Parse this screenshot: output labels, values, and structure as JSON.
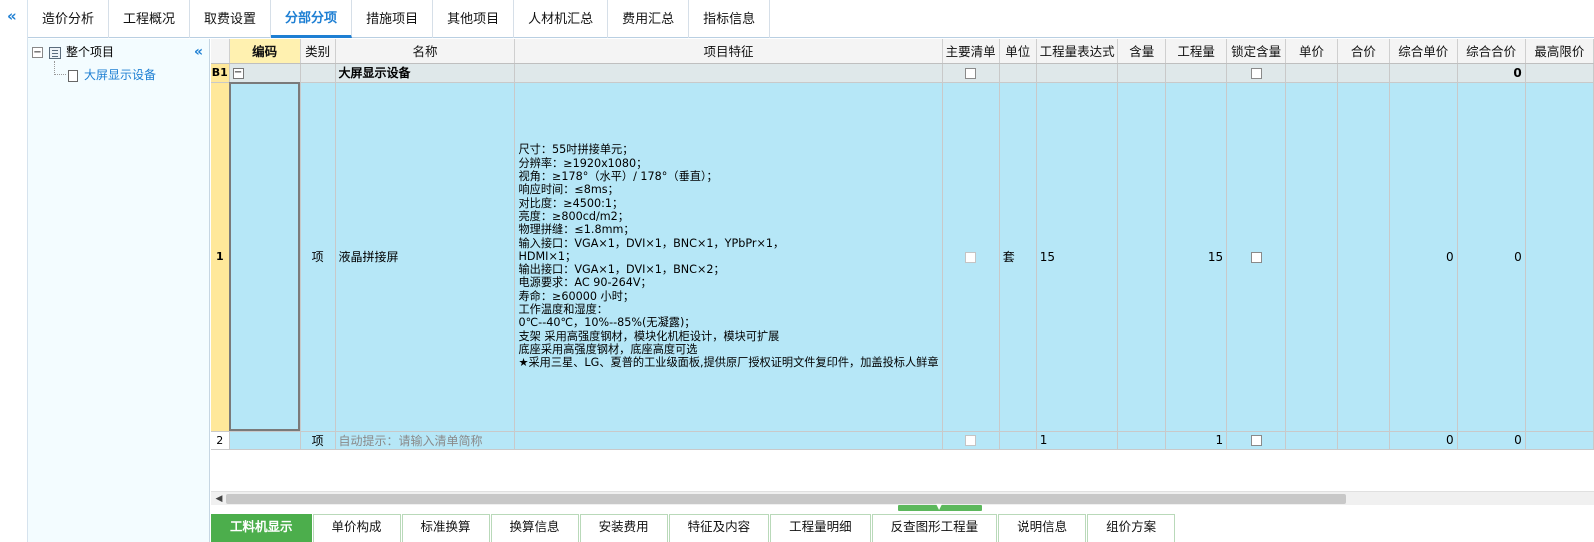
{
  "top_tabs": [
    "造价分析",
    "工程概况",
    "取费设置",
    "分部分项",
    "措施项目",
    "其他项目",
    "人材机汇总",
    "费用汇总",
    "指标信息"
  ],
  "active_top_tab": "分部分项",
  "tree": {
    "root_label": "整个项目",
    "root_toggle": "−",
    "child_label": "大屏显示设备"
  },
  "columns": [
    "",
    "编码",
    "类别",
    "名称",
    "项目特征",
    "主要清单",
    "单位",
    "工程量表达式",
    "含量",
    "工程量",
    "锁定含量",
    "单价",
    "合价",
    "综合单价",
    "综合合价",
    "最高限价"
  ],
  "rows": {
    "section": {
      "num": "B1",
      "toggle": "−",
      "name": "大屏显示设备",
      "total": "0"
    },
    "item1": {
      "num": "1",
      "type": "项",
      "name": "液晶拼接屏",
      "feature_lines": [
        "尺寸：55吋拼接单元；",
        "分辨率：≥1920x1080；",
        "视角：≥178°（水平）/ 178°（垂直）；",
        "响应时间：≤8ms；",
        "对比度：≥4500:1；",
        "亮度：≥800cd/m2；",
        "物理拼缝：≤1.8mm；",
        "输入接口：VGA×1，DVI×1，BNC×1，YPbPr×1，",
        "HDMI×1；",
        "输出接口：VGA×1，DVI×1，BNC×2；",
        "电源要求：AC 90-264V；",
        "寿命：≥60000 小时；",
        "工作温度和湿度：",
        "0℃--40℃，10%--85%(无凝露)；",
        "支架 采用高强度钢材，模块化机柜设计，模块可扩展",
        "底座采用高强度钢材，底座高度可选",
        "★采用三星、LG、夏普的工业级面板,提供原厂授权证明文件复印件，加盖投标人鲜章"
      ],
      "unit": "套",
      "expression": "15",
      "quantity": "15",
      "composite_price": "0",
      "composite_total": "0"
    },
    "item2": {
      "num": "2",
      "type": "项",
      "name_hint": "自动提示：请输入清单简称",
      "expression": "1",
      "quantity": "1",
      "composite_price": "0",
      "composite_total": "0"
    }
  },
  "bottom_tabs": [
    "工料机显示",
    "单价构成",
    "标准换算",
    "换算信息",
    "安装费用",
    "特征及内容",
    "工程量明细",
    "反查图形工程量",
    "说明信息",
    "组价方案"
  ],
  "active_bottom_tab": "工料机显示",
  "colors": {
    "accent": "#1e7fd3",
    "row_selected": "#b6e7f7",
    "row_header": "#ffe89a",
    "bottom_tab_active": "#4cae4c"
  }
}
